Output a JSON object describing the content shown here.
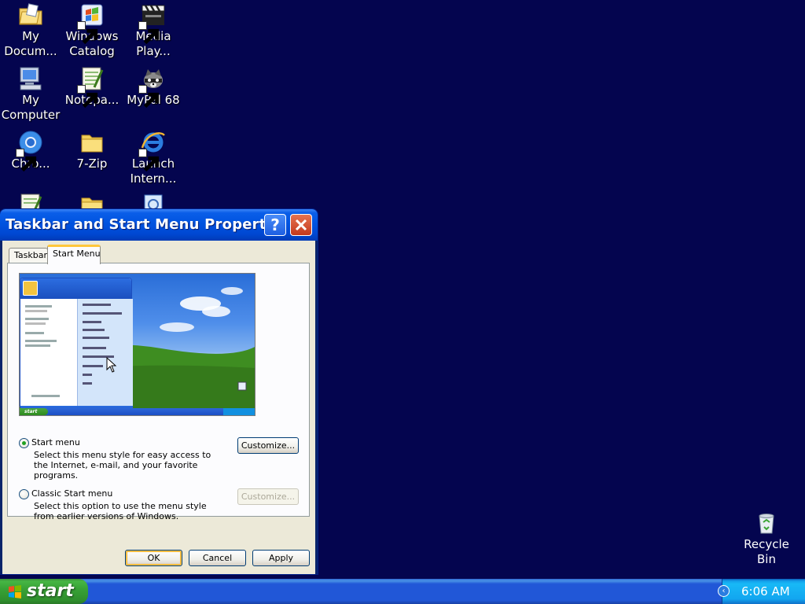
{
  "desktop": {
    "icons": [
      {
        "label": "My Docum..."
      },
      {
        "label": "Windows Catalog"
      },
      {
        "label": "Media Play..."
      },
      {
        "label": "My Computer"
      },
      {
        "label": "Notepa..."
      },
      {
        "label": "MyPal 68"
      },
      {
        "label": "Chro..."
      },
      {
        "label": "7-Zip"
      },
      {
        "label": "Launch Intern..."
      }
    ],
    "recycle_bin": {
      "label": "Recycle Bin"
    }
  },
  "dialog": {
    "title": "Taskbar and Start Menu Propert...",
    "help_glyph": "?",
    "tabs": [
      {
        "label": "Taskbar"
      },
      {
        "label": "Start Menu"
      }
    ],
    "active_tab": "Start Menu",
    "preview": {
      "start_label": "start"
    },
    "options": [
      {
        "label": "Start menu",
        "selected": true,
        "description": "Select this menu style for easy access to the Internet, e-mail, and your favorite programs.",
        "customize_label": "Customize...",
        "customize_enabled": true
      },
      {
        "label": "Classic Start menu",
        "selected": false,
        "description": "Select this option to use the menu style from earlier versions of Windows.",
        "customize_label": "Customize...",
        "customize_enabled": false
      }
    ],
    "buttons": {
      "ok": "OK",
      "cancel": "Cancel",
      "apply": "Apply"
    }
  },
  "taskbar": {
    "start_label": "start",
    "clock": "6:06 AM",
    "tray_chevron": "‹"
  },
  "colors": {
    "desktop_bg": "#04054f",
    "titlebar_blue": "#0053e0",
    "taskbar_blue": "#2157d7",
    "start_green": "#38a236",
    "dialog_face": "#ece9d8"
  }
}
